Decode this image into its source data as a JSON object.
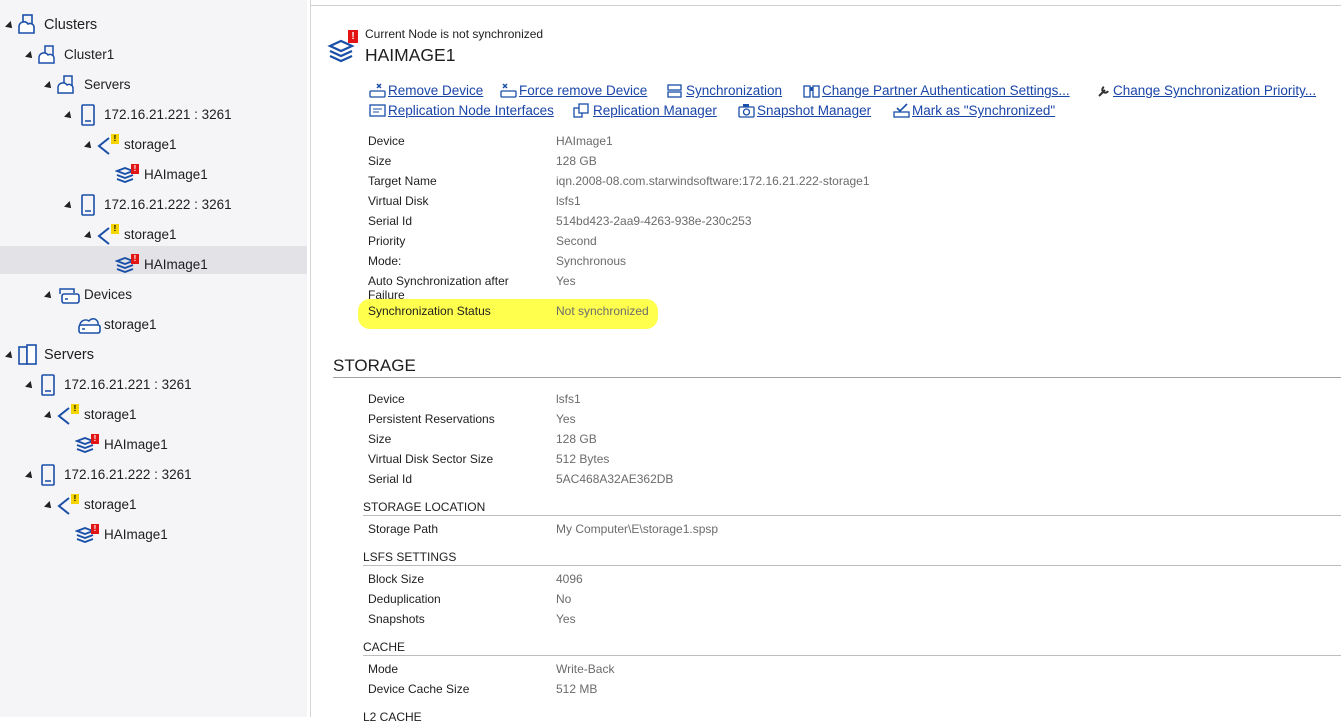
{
  "tree": {
    "clusters_label": "Clusters",
    "cluster1_label": "Cluster1",
    "servers_label": "Servers",
    "server_221": "172.16.21.221 : 3261",
    "server_222": "172.16.21.222 : 3261",
    "storage_label": "storage1",
    "haimage_label": "HAImage1",
    "devices_label": "Devices",
    "device_storage": "storage1",
    "root_servers_label": "Servers",
    "warn_mark": "!",
    "err_mark": "!"
  },
  "header": {
    "notice": "Current Node is not synchronized",
    "title": "HAIMAGE1"
  },
  "actions": {
    "remove_device": "Remove Device",
    "force_remove": "Force remove Device",
    "synchronization": "Synchronization",
    "change_partner_auth": "Change Partner Authentication Settings...",
    "change_sync_priority": "Change Synchronization Priority...",
    "replication_interfaces": "Replication Node Interfaces",
    "replication_manager": "Replication Manager",
    "snapshot_manager": "Snapshot Manager",
    "mark_synchronized": "Mark as \"Synchronized\""
  },
  "device_props": [
    {
      "k": "Device",
      "v": "HAImage1"
    },
    {
      "k": "Size",
      "v": "128 GB"
    },
    {
      "k": "Target Name",
      "v": "iqn.2008-08.com.starwindsoftware:172.16.21.222-storage1"
    },
    {
      "k": "Virtual Disk",
      "v": "lsfs1"
    },
    {
      "k": "Serial Id",
      "v": "514bd423-2aa9-4263-938e-230c253"
    },
    {
      "k": "Priority",
      "v": "Second"
    },
    {
      "k": "Mode:",
      "v": "Synchronous"
    },
    {
      "k": "Auto Synchronization after Failure",
      "v": "Yes"
    },
    {
      "k": "Synchronization Status",
      "v": "Not synchronized"
    }
  ],
  "storage": {
    "title": "STORAGE",
    "props": [
      {
        "k": "Device",
        "v": "lsfs1"
      },
      {
        "k": "Persistent Reservations",
        "v": "Yes"
      },
      {
        "k": "Size",
        "v": "128 GB"
      },
      {
        "k": "Virtual Disk Sector Size",
        "v": "512 Bytes"
      },
      {
        "k": "Serial Id",
        "v": "5AC468A32AE362DB"
      }
    ],
    "location_title": "STORAGE LOCATION",
    "location": [
      {
        "k": "Storage Path",
        "v": "My Computer\\E\\storage1.spsp"
      }
    ],
    "lsfs_title": "LSFS SETTINGS",
    "lsfs": [
      {
        "k": "Block Size",
        "v": "4096"
      },
      {
        "k": "Deduplication",
        "v": "No"
      },
      {
        "k": "Snapshots",
        "v": "Yes"
      }
    ],
    "cache_title": "CACHE",
    "cache": [
      {
        "k": "Mode",
        "v": "Write-Back"
      },
      {
        "k": "Device Cache Size",
        "v": "512 MB"
      }
    ],
    "l2_title": "L2 CACHE"
  },
  "colors": {
    "link": "#1a45a8",
    "icon": "#1a4fa8",
    "highlight": "#ffff4d",
    "warning": "#f5d500",
    "error": "#e31414"
  },
  "icons": [
    "cluster-icon",
    "server-icon",
    "storage-target-icon",
    "device-stack-icon",
    "devices-icon",
    "remove-icon",
    "sync-icon",
    "auth-icon",
    "wrench-icon",
    "interfaces-icon",
    "replication-icon",
    "snapshot-icon",
    "mark-icon"
  ]
}
